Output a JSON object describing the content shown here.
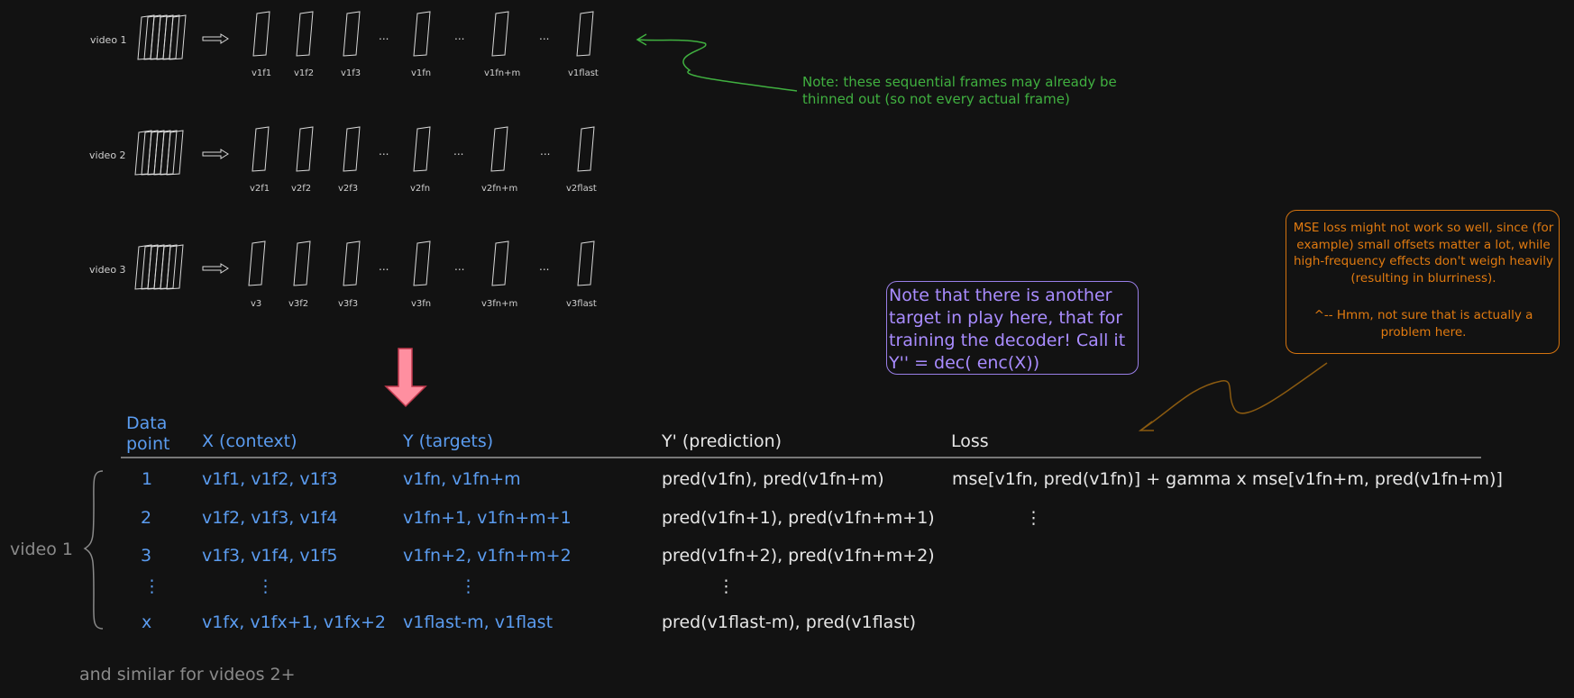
{
  "videos": [
    {
      "label": "video 1",
      "frames": [
        {
          "label": "v1f1"
        },
        {
          "label": "v1f2"
        },
        {
          "label": "v1f3"
        },
        {
          "label": "..."
        },
        {
          "label": "v1fn"
        },
        {
          "label": "..."
        },
        {
          "label": "v1fn+m"
        },
        {
          "label": "..."
        },
        {
          "label": "v1flast"
        }
      ]
    },
    {
      "label": "video 2",
      "frames": [
        {
          "label": "v2f1"
        },
        {
          "label": "v2f2"
        },
        {
          "label": "v2f3"
        },
        {
          "label": "..."
        },
        {
          "label": "v2fn"
        },
        {
          "label": "..."
        },
        {
          "label": "v2fn+m"
        },
        {
          "label": "..."
        },
        {
          "label": "v2flast"
        }
      ]
    },
    {
      "label": "video 3",
      "frames": [
        {
          "label": "v3"
        },
        {
          "label": "v3f2"
        },
        {
          "label": "v3f3"
        },
        {
          "label": "..."
        },
        {
          "label": "v3fn"
        },
        {
          "label": "..."
        },
        {
          "label": "v3fn+m"
        },
        {
          "label": "..."
        },
        {
          "label": "v3flast"
        }
      ]
    }
  ],
  "notes": {
    "frames_note": "Note: these sequential frames may already be thinned out (so not every actual frame)",
    "decoder_note": "Note that there is another target in play here, that for training the decoder! Call it Y'' = dec( enc(X))",
    "mse_note_1": "MSE loss might not work so well, since (for example) small offsets matter a lot, while high-frequency effects don't weigh heavily (resulting in blurriness).",
    "mse_note_2": "^-- Hmm, not sure that is actually a problem here."
  },
  "table": {
    "headers": {
      "data_point": "Data point",
      "x": "X (context)",
      "y": "Y (targets)",
      "y_pred": "Y' (prediction)",
      "loss": "Loss"
    },
    "rows": [
      {
        "point": "1",
        "x": "v1f1, v1f2, v1f3",
        "y": "v1fn, v1fn+m",
        "pred": "pred(v1fn), pred(v1fn+m)",
        "loss": "mse[v1fn, pred(v1fn)] + gamma x mse[v1fn+m, pred(v1fn+m)]"
      },
      {
        "point": "2",
        "x": "v1f2, v1f3, v1f4",
        "y": "v1fn+1, v1fn+m+1",
        "pred": "pred(v1fn+1), pred(v1fn+m+1)",
        "loss": "⋮"
      },
      {
        "point": "3",
        "x": "v1f3, v1f4, v1f5",
        "y": "v1fn+2, v1fn+m+2",
        "pred": "pred(v1fn+2), pred(v1fn+m+2)",
        "loss": ""
      },
      {
        "point": "⋮",
        "x": "⋮",
        "y": "⋮",
        "pred": "⋮",
        "loss": ""
      },
      {
        "point": "x",
        "x": "v1fx, v1fx+1, v1fx+2",
        "y": "v1flast-m, v1flast",
        "pred": "pred(v1flast-m), pred(v1flast)",
        "loss": ""
      }
    ],
    "group_label": "video 1",
    "footer": "and similar for videos 2+"
  },
  "colors": {
    "background": "#121212",
    "blue": "#5b9cf0",
    "green": "#40b040",
    "orange": "#e07a10",
    "purple": "#a98cff",
    "arrow_fill": "#ff8fa0",
    "arrow_stroke": "#c0394d"
  }
}
